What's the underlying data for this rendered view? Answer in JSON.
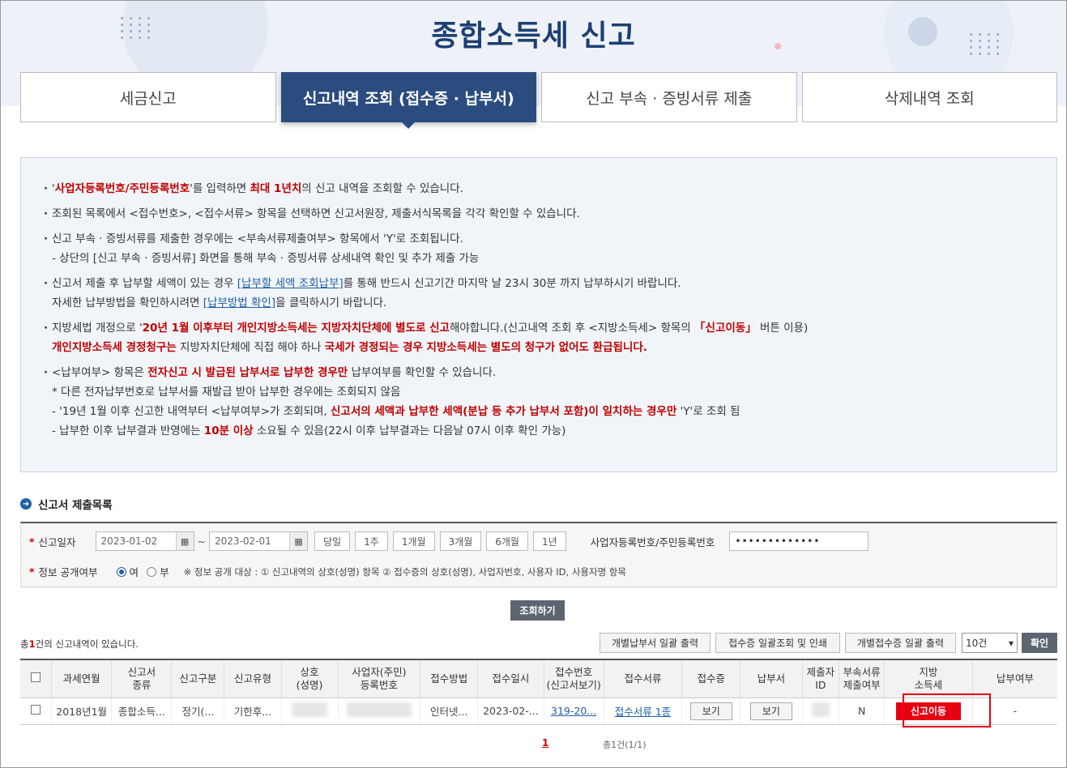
{
  "page": {
    "title": "종합소득세 신고"
  },
  "tabs": [
    {
      "label": "세금신고",
      "active": false
    },
    {
      "label": "신고내역 조회 (접수증 · 납부서)",
      "active": true
    },
    {
      "label": "신고 부속 · 증빙서류 제출",
      "active": false
    },
    {
      "label": "삭제내역 조회",
      "active": false
    }
  ],
  "notice": {
    "l1": {
      "a": "'",
      "b": "사업자등록번호/주민등록번호",
      "c": "'를 입력하면 ",
      "d": "최대 1년치",
      "e": "의 신고 내역을 조회할 수 있습니다."
    },
    "l2": "조회된 목록에서 <접수번호>, <접수서류> 항목을 선택하면 신고서원장, 제출서식목록을 각각 확인할 수 있습니다.",
    "l3": "신고 부속 · 증빙서류를 제출한 경우에는 <부속서류제출여부> 항목에서 'Y'로 조회됩니다.",
    "l4": "- 상단의 [신고 부속 · 증빙서류] 화면을 통해 부속 · 증빙서류 상세내역 확인 및 추가 제출 가능",
    "l5": {
      "a": "신고서 제출 후 납부할 세액이 있는 경우 ",
      "link": "[납부할 세액 조회납부]",
      "b": "를 통해 반드시 신고기간 마지막 날 23시 30분 까지 납부하시기 바랍니다."
    },
    "l6": {
      "a": "자세한 납부방법을 확인하시려면 ",
      "link": "[납부방법 확인]",
      "b": "을 클릭하시기 바랍니다."
    },
    "l7": {
      "a": "지방세법 개정으로 '",
      "b": "20년 1월 이후부터 개인지방소득세는 지방자치단체에 별도로 신고",
      "c": "해야합니다.(신고내역 조회 후 <지방소득세> 항목의 ",
      "d": "「신고이동」",
      "e": " 버튼 이용)"
    },
    "l8": {
      "a": "개인지방소득세 경정청구는",
      "b": " 지방자치단체에 직접 해야 하나 ",
      "c": "국세가 경정되는 경우 지방소득세는 별도의 청구가 없어도 환급됩니다."
    },
    "l9": {
      "a": "<납부여부> 항목은 ",
      "b": "전자신고 시 발급된 납부서로 납부한 경우만",
      "c": " 납부여부를 확인할 수 있습니다."
    },
    "l10": " * 다른 전자납부번호로 납부서를 재발급 받아 납부한 경우에는 조회되지 않음",
    "l11": {
      "a": "- '19년 1월 이후 신고한 내역부터 <납부여부>가 조회되며, ",
      "b": "신고서의 세액과 납부한 세액(분납 등 추가 납부서 포함)이 일치하는 경우만",
      "c": " 'Y'로 조회 됨"
    },
    "l12": {
      "a": "- 납부한 이후 납부결과 반영에는 ",
      "b": "10분 이상",
      "c": " 소요될 수 있음(22시 이후 납부결과는 다음날 07시 이후 확인 가능)"
    }
  },
  "section": {
    "title": "신고서 제출목록"
  },
  "search": {
    "date_label": "신고일자",
    "date_from": "2023-01-02",
    "date_to": "2023-02-01",
    "tilde": "~",
    "periods": [
      "당일",
      "1주",
      "1개월",
      "3개월",
      "6개월",
      "1년"
    ],
    "id_label": "사업자등록번호/주민등록번호",
    "id_value": "•••••••••••••",
    "disclose_label": "정보 공개여부",
    "opt_yes": "여",
    "opt_no": "부",
    "opt_selected": "여",
    "disclose_note": "※ 정보 공개 대상 : ① 신고내역의 상호(성명) 항목 ② 접수증의 상호(성명), 사업자번호, 사용자 ID, 사용자명 항목",
    "submit": "조회하기"
  },
  "list": {
    "count_a": "총",
    "count_n": "1",
    "count_b": "건의 신고내역이 있습니다.",
    "btn1": "개별납부서 일괄 출력",
    "btn2": "접수증 일괄조회 및 인쇄",
    "btn3": "개별접수증 일괄 출력",
    "page_size": "10건",
    "confirm": "확인",
    "headers": [
      "",
      "과세연월",
      "신고서\n종류",
      "신고구분",
      "신고유형",
      "상호\n(성명)",
      "사업자(주민)\n등록번호",
      "접수방법",
      "접수일시",
      "접수번호\n(신고서보기)",
      "접수서류",
      "접수증",
      "납부서",
      "제출자\nID",
      "부속서류\n제출여부",
      "지방\n소득세",
      "납부여부"
    ],
    "row": {
      "period": "2018년1월",
      "kind": "종합소득...",
      "category": "정기(...",
      "type": "기한후...",
      "method": "인터넷...",
      "datetime": "2023-02-...",
      "receipt_no": "319-20...",
      "docs": "접수서류 1종",
      "view1": "보기",
      "view2": "보기",
      "attached": "N",
      "local_btn": "신고이동",
      "paid": "-"
    }
  },
  "pager": {
    "current": "1",
    "summary": "총1건(1/1)"
  }
}
